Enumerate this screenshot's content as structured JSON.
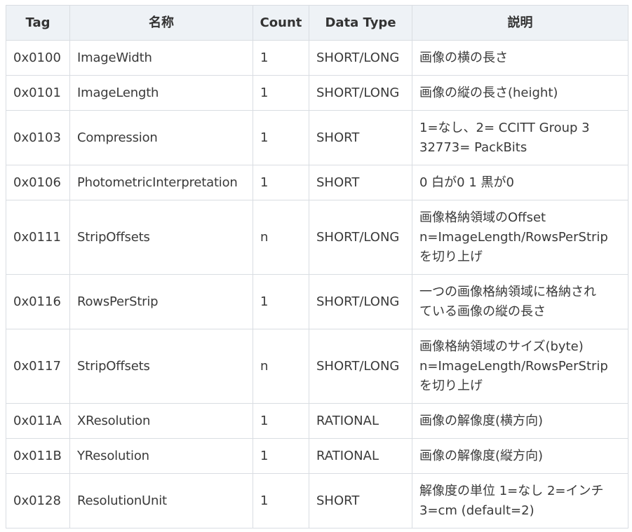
{
  "table": {
    "headers": [
      "Tag",
      "名称",
      "Count",
      "Data Type",
      "説明"
    ],
    "rows": [
      {
        "tag": "0x0100",
        "name": "ImageWidth",
        "count": "1",
        "type": "SHORT/LONG",
        "desc": "画像の横の長さ"
      },
      {
        "tag": "0x0101",
        "name": "ImageLength",
        "count": "1",
        "type": "SHORT/LONG",
        "desc": "画像の縦の長さ(height)"
      },
      {
        "tag": "0x0103",
        "name": "Compression",
        "count": "1",
        "type": "SHORT",
        "desc": "1=なし、2= CCITT Group 3\n32773= PackBits"
      },
      {
        "tag": "0x0106",
        "name": "PhotometricInterpretation",
        "count": "1",
        "type": "SHORT",
        "desc": "0 白が0 1 黒が0"
      },
      {
        "tag": "0x0111",
        "name": "StripOffsets",
        "count": "n",
        "type": "SHORT/LONG",
        "desc": "画像格納領域のOffset\nn=ImageLength/RowsPerStrip\nを切り上げ"
      },
      {
        "tag": "0x0116",
        "name": "RowsPerStrip",
        "count": "1",
        "type": "SHORT/LONG",
        "desc": "一つの画像格納領域に格納され\nている画像の縦の長さ"
      },
      {
        "tag": "0x0117",
        "name": "StripOffsets",
        "count": "n",
        "type": "SHORT/LONG",
        "desc": "画像格納領域のサイズ(byte)\nn=ImageLength/RowsPerStrip\nを切り上げ"
      },
      {
        "tag": "0x011A",
        "name": "XResolution",
        "count": "1",
        "type": "RATIONAL",
        "desc": "画像の解像度(横方向)"
      },
      {
        "tag": "0x011B",
        "name": "YResolution",
        "count": "1",
        "type": "RATIONAL",
        "desc": "画像の解像度(縦方向)"
      },
      {
        "tag": "0x0128",
        "name": "ResolutionUnit",
        "count": "1",
        "type": "SHORT",
        "desc": "解像度の単位 1=なし 2=インチ\n3=cm (default=2)"
      }
    ]
  }
}
